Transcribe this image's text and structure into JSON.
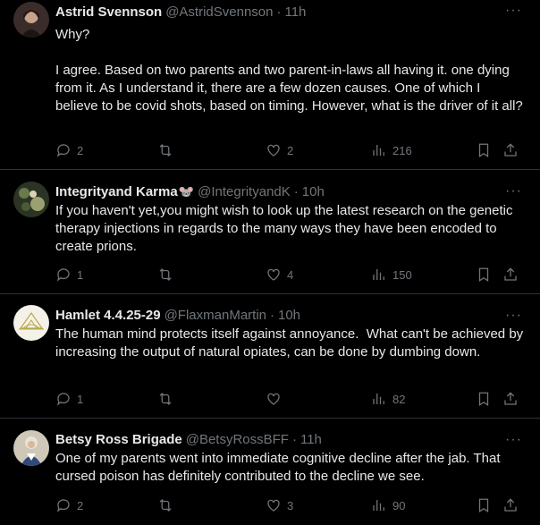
{
  "tweets": [
    {
      "name": "Astrid Svennson",
      "handle": "@AstridSvennson",
      "time": "11h",
      "text": "Why?\n\nI agree. Based on two parents and two parent-in-laws all having it. one dying from it. As I understand it, there are a few dozen causes. One of which I believe to be covid shots, based on timing. However, what is the driver of it all?",
      "replies": "2",
      "retweets": "",
      "likes": "2",
      "views": "216"
    },
    {
      "name": "Integrityand Karma",
      "handle": "@IntegrityandK",
      "time": "10h",
      "text": "If you haven't yet,you might wish to look up the latest research on the genetic therapy injections in regards to the many ways they have been encoded to create prions.",
      "replies": "1",
      "retweets": "",
      "likes": "4",
      "views": "150"
    },
    {
      "name": "Hamlet 4.4.25-29",
      "handle": "@FlaxmanMartin",
      "time": "10h",
      "text": "The human mind protects itself against annoyance.  What can't be achieved by increasing the output of natural opiates, can be done by dumbing down.",
      "replies": "1",
      "retweets": "",
      "likes": "",
      "views": "82"
    },
    {
      "name": "Betsy Ross Brigade",
      "handle": "@BetsyRossBFF",
      "time": "11h",
      "text": "One of my parents went into immediate cognitive decline after the jab. That cursed poison has definitely contributed to the decline we see.",
      "replies": "2",
      "retweets": "",
      "likes": "3",
      "views": "90"
    }
  ],
  "separator": "·",
  "more_label": "···",
  "name_emoji": "🐭",
  "icons": [
    "reply-icon",
    "retweet-icon",
    "like-icon",
    "views-icon",
    "bookmark-icon",
    "share-icon",
    "more-icon"
  ]
}
